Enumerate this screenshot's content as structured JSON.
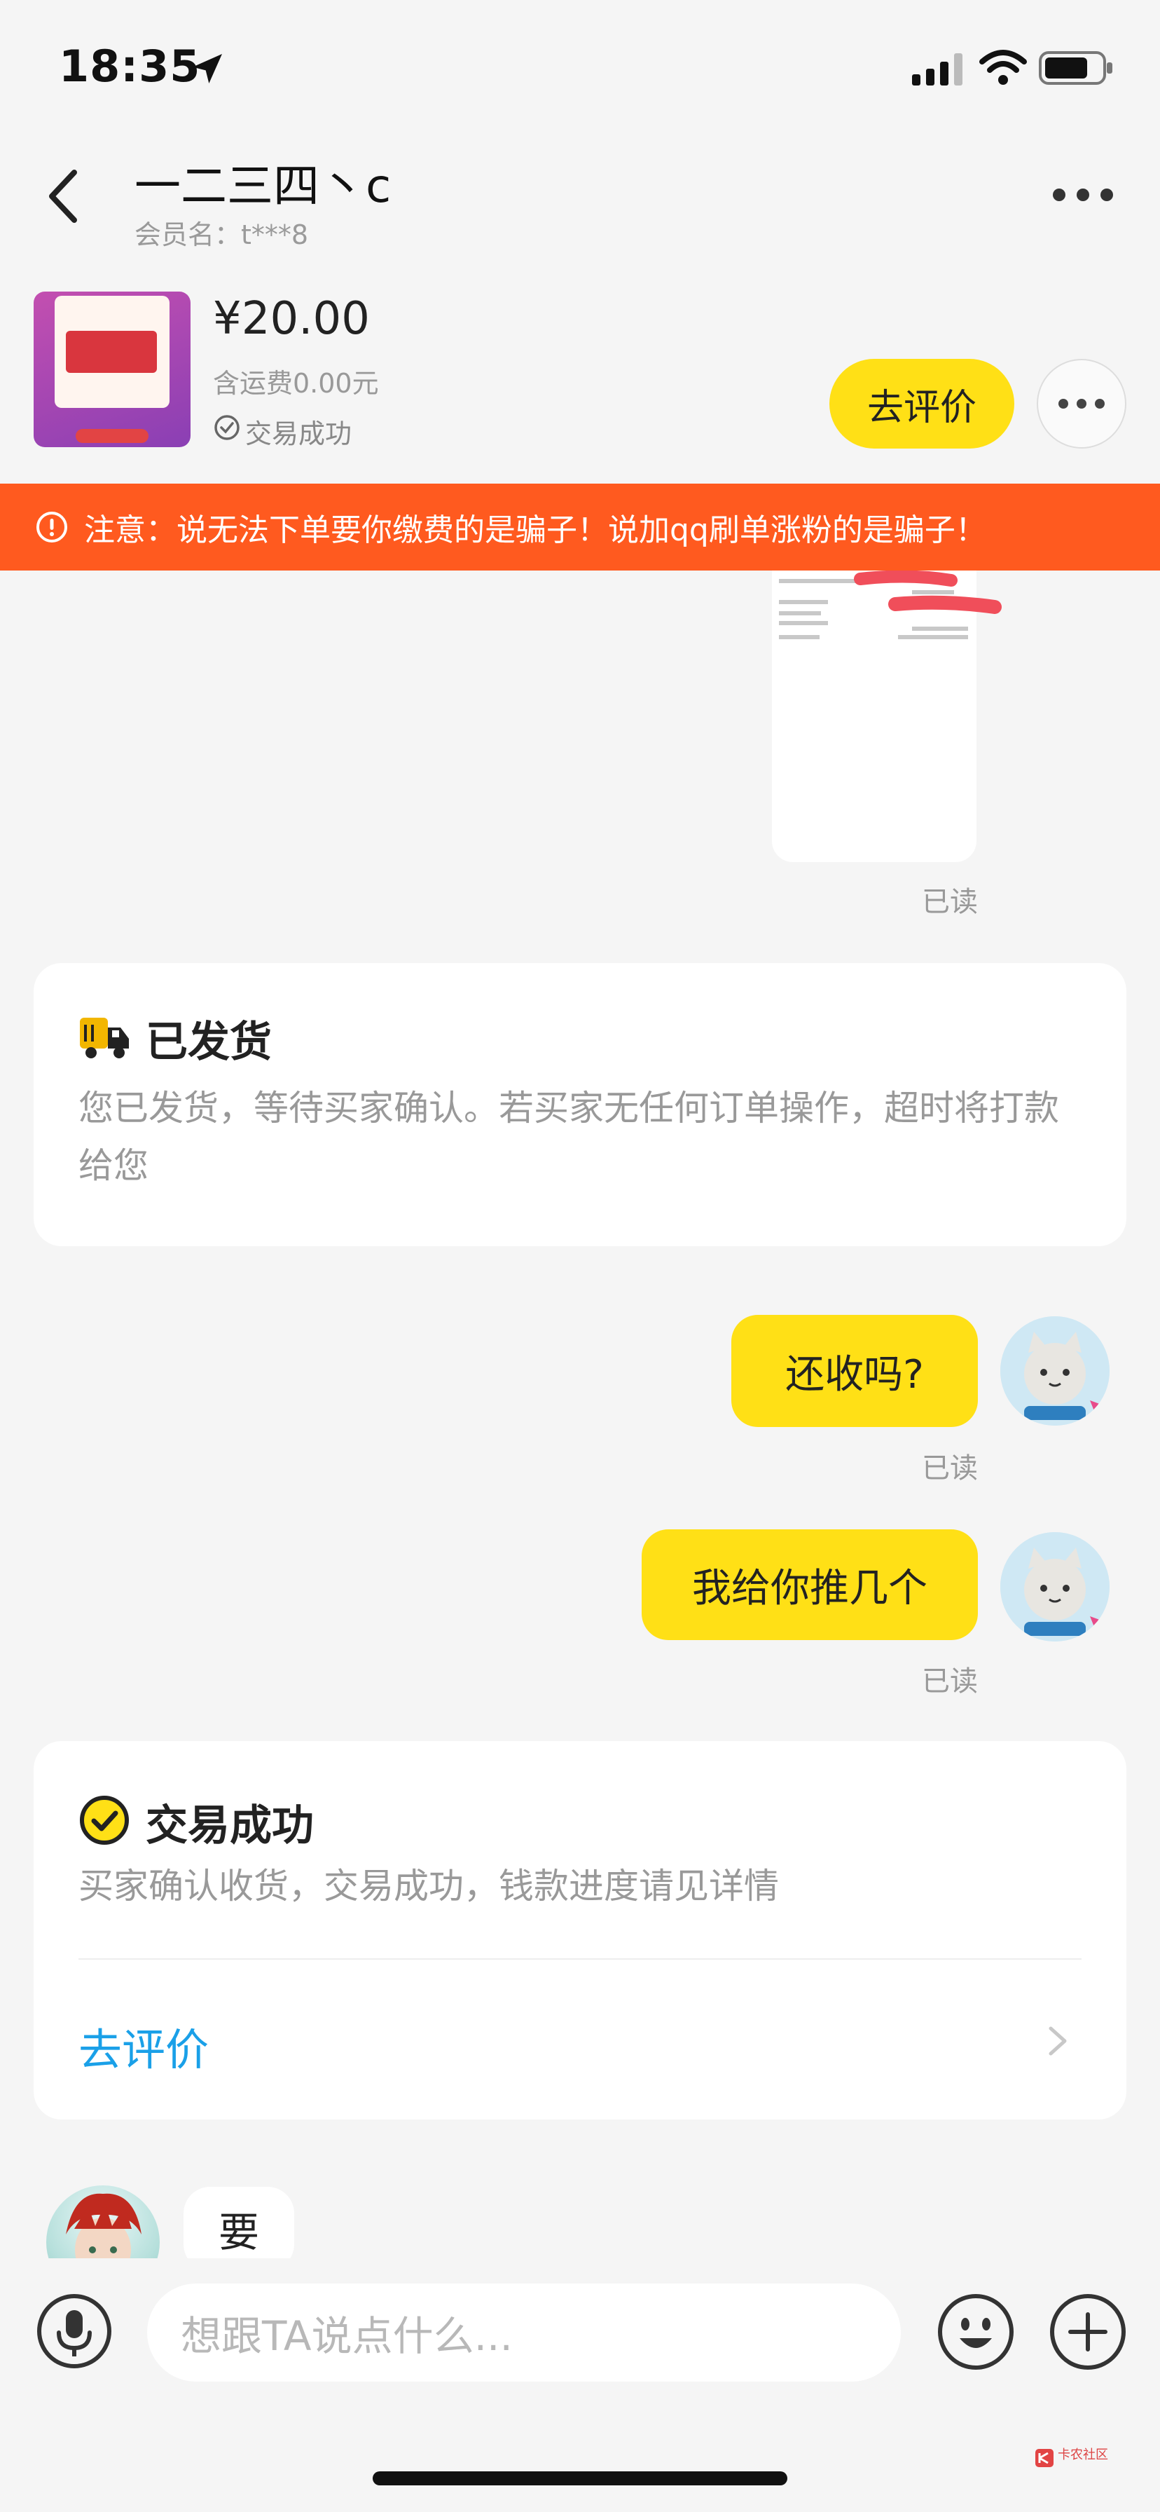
{
  "status_bar": {
    "time": "18:35"
  },
  "header": {
    "title": "一二三四丶c",
    "member": "会员名：t***8"
  },
  "product": {
    "price": "¥20.00",
    "shipping": "含运费0.00元",
    "status": "交易成功",
    "review_button": "去评价"
  },
  "warning": {
    "text": "注意：说无法下单要你缴费的是骗子！说加qq刷单涨粉的是骗子！"
  },
  "messages": {
    "read_label": "已读",
    "msg1": "还收吗?",
    "msg2": "我给你推几个",
    "incoming": "要"
  },
  "shipped_card": {
    "title": "已发货",
    "desc": "您已发货，等待买家确认。若买家无任何订单操作，超时将打款给您"
  },
  "success_card": {
    "title": "交易成功",
    "desc": "买家确认收货，交易成功，钱款进度请见详情",
    "action": "去评价"
  },
  "input_bar": {
    "placeholder": "想跟TA说点什么..."
  },
  "watermark": {
    "text": "卡农社区"
  },
  "colors": {
    "accent_yellow": "#ffe016",
    "warning_orange": "#ff5a1f",
    "link_blue": "#1aa0e8"
  }
}
